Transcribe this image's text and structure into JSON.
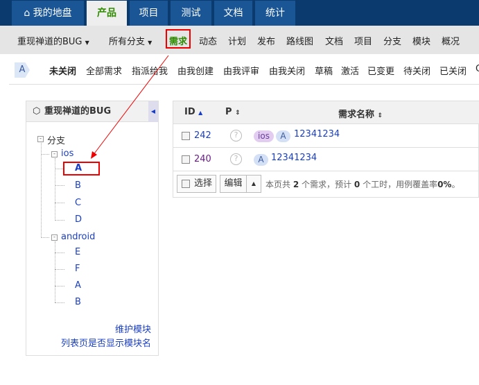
{
  "topnav": {
    "tabs": [
      "我的地盘",
      "产品",
      "项目",
      "测试",
      "文档",
      "统计"
    ],
    "active": 1
  },
  "subnav": {
    "product": "重现禅道的BUG",
    "branch": "所有分支",
    "items": [
      "需求",
      "动态",
      "计划",
      "发布",
      "路线图",
      "文档",
      "项目",
      "分支",
      "模块",
      "概况"
    ],
    "active": 0
  },
  "filter": {
    "module_badge": "A",
    "items": [
      "未关闭",
      "全部需求",
      "指派给我",
      "由我创建",
      "由我评审",
      "由我关闭",
      "草稿",
      "激活",
      "已变更",
      "待关闭",
      "已关闭"
    ]
  },
  "sidebar": {
    "title": "重现禅道的BUG",
    "root": "分支",
    "branches": [
      {
        "name": "ios",
        "modules": [
          "A",
          "B",
          "C",
          "D"
        ]
      },
      {
        "name": "android",
        "modules": [
          "E",
          "F",
          "A",
          "B"
        ]
      }
    ],
    "links": [
      "维护模块",
      "列表页是否显示模块名"
    ]
  },
  "table": {
    "headers": [
      "ID",
      "P",
      "需求名称"
    ],
    "rows": [
      {
        "id": "242",
        "pri": "?",
        "tags": [
          "ios",
          "A"
        ],
        "name": "12341234"
      },
      {
        "id": "240",
        "pri": "?",
        "tags": [
          "A"
        ],
        "name": "12341234"
      }
    ],
    "footer": {
      "select": "选择",
      "edit": "编辑",
      "summary_prefix": "本页共",
      "count": "2",
      "mid1": "个需求，预计",
      "hours": "0",
      "mid2": "个工时，用例覆盖率",
      "coverage": "0%",
      "end": "。"
    }
  },
  "colors": {
    "topbar": "#0a3a6e",
    "tab": "#1a5696",
    "active_green": "#2e8b00",
    "link": "#1a3ec2",
    "highlight": "#e00000"
  }
}
